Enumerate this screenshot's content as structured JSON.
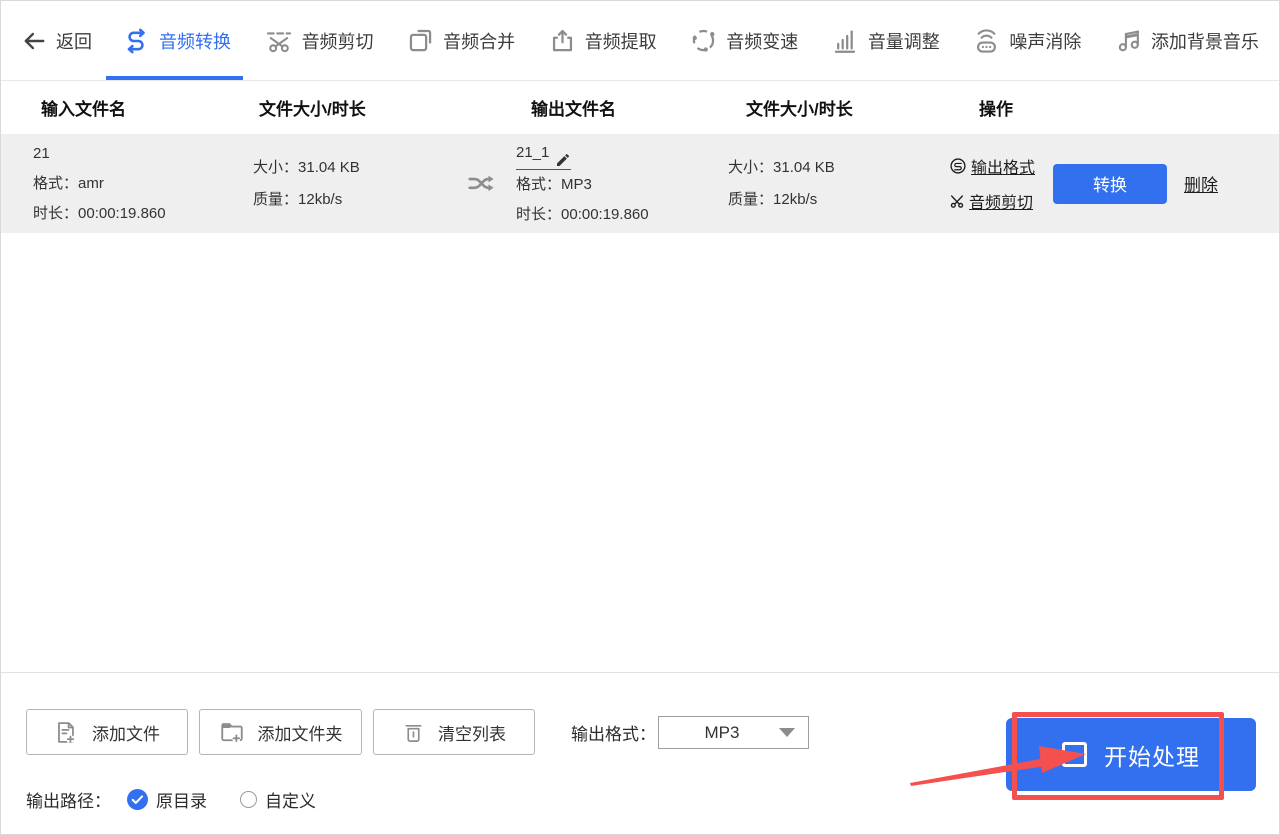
{
  "colors": {
    "accent": "#3370f0",
    "row_background": "#efefef",
    "annotation_red": "#f4504e",
    "icon_gray": "#8c8c8c"
  },
  "toolbar": {
    "back_label": "返回",
    "tabs": [
      {
        "label": "音频转换",
        "icon": "audio-convert-icon",
        "active": true
      },
      {
        "label": "音频剪切",
        "icon": "audio-cut-icon",
        "active": false
      },
      {
        "label": "音频合并",
        "icon": "audio-merge-icon",
        "active": false
      },
      {
        "label": "音频提取",
        "icon": "audio-extract-icon",
        "active": false
      },
      {
        "label": "音频变速",
        "icon": "audio-speed-icon",
        "active": false
      },
      {
        "label": "音量调整",
        "icon": "volume-adjust-icon",
        "active": false
      },
      {
        "label": "噪声消除",
        "icon": "noise-removal-icon",
        "active": false
      },
      {
        "label": "添加背景音乐",
        "icon": "background-music-icon",
        "active": false
      }
    ]
  },
  "table": {
    "headers": {
      "input_name": "输入文件名",
      "input_size": "文件大小/时长",
      "output_name": "输出文件名",
      "output_size": "文件大小/时长",
      "actions": "操作"
    },
    "row": {
      "input_name": "21",
      "input_format_label": "格式：",
      "input_format": "amr",
      "input_duration_label": "时长：",
      "input_duration": "00:00:19.860",
      "input_size_label": "大小：",
      "input_size": "31.04 KB",
      "input_quality_label": "质量：",
      "input_quality": "12kb/s",
      "output_name": "21_1",
      "output_format_label": "格式：",
      "output_format": "MP3",
      "output_duration_label": "时长：",
      "output_duration": "00:00:19.860",
      "output_size_label": "大小：",
      "output_size": "31.04 KB",
      "output_quality_label": "质量：",
      "output_quality": "12kb/s",
      "output_format_link": "输出格式",
      "audio_cut_link": "音频剪切",
      "convert_button": "转换",
      "delete_link": "删除"
    }
  },
  "footer": {
    "add_file_button": "添加文件",
    "add_folder_button": "添加文件夹",
    "clear_list_button": "清空列表",
    "output_format_label": "输出格式：",
    "output_format_value": "MP3",
    "start_button": "开始处理",
    "output_path_label": "输出路径：",
    "path_original": "原目录",
    "path_custom": "自定义"
  }
}
